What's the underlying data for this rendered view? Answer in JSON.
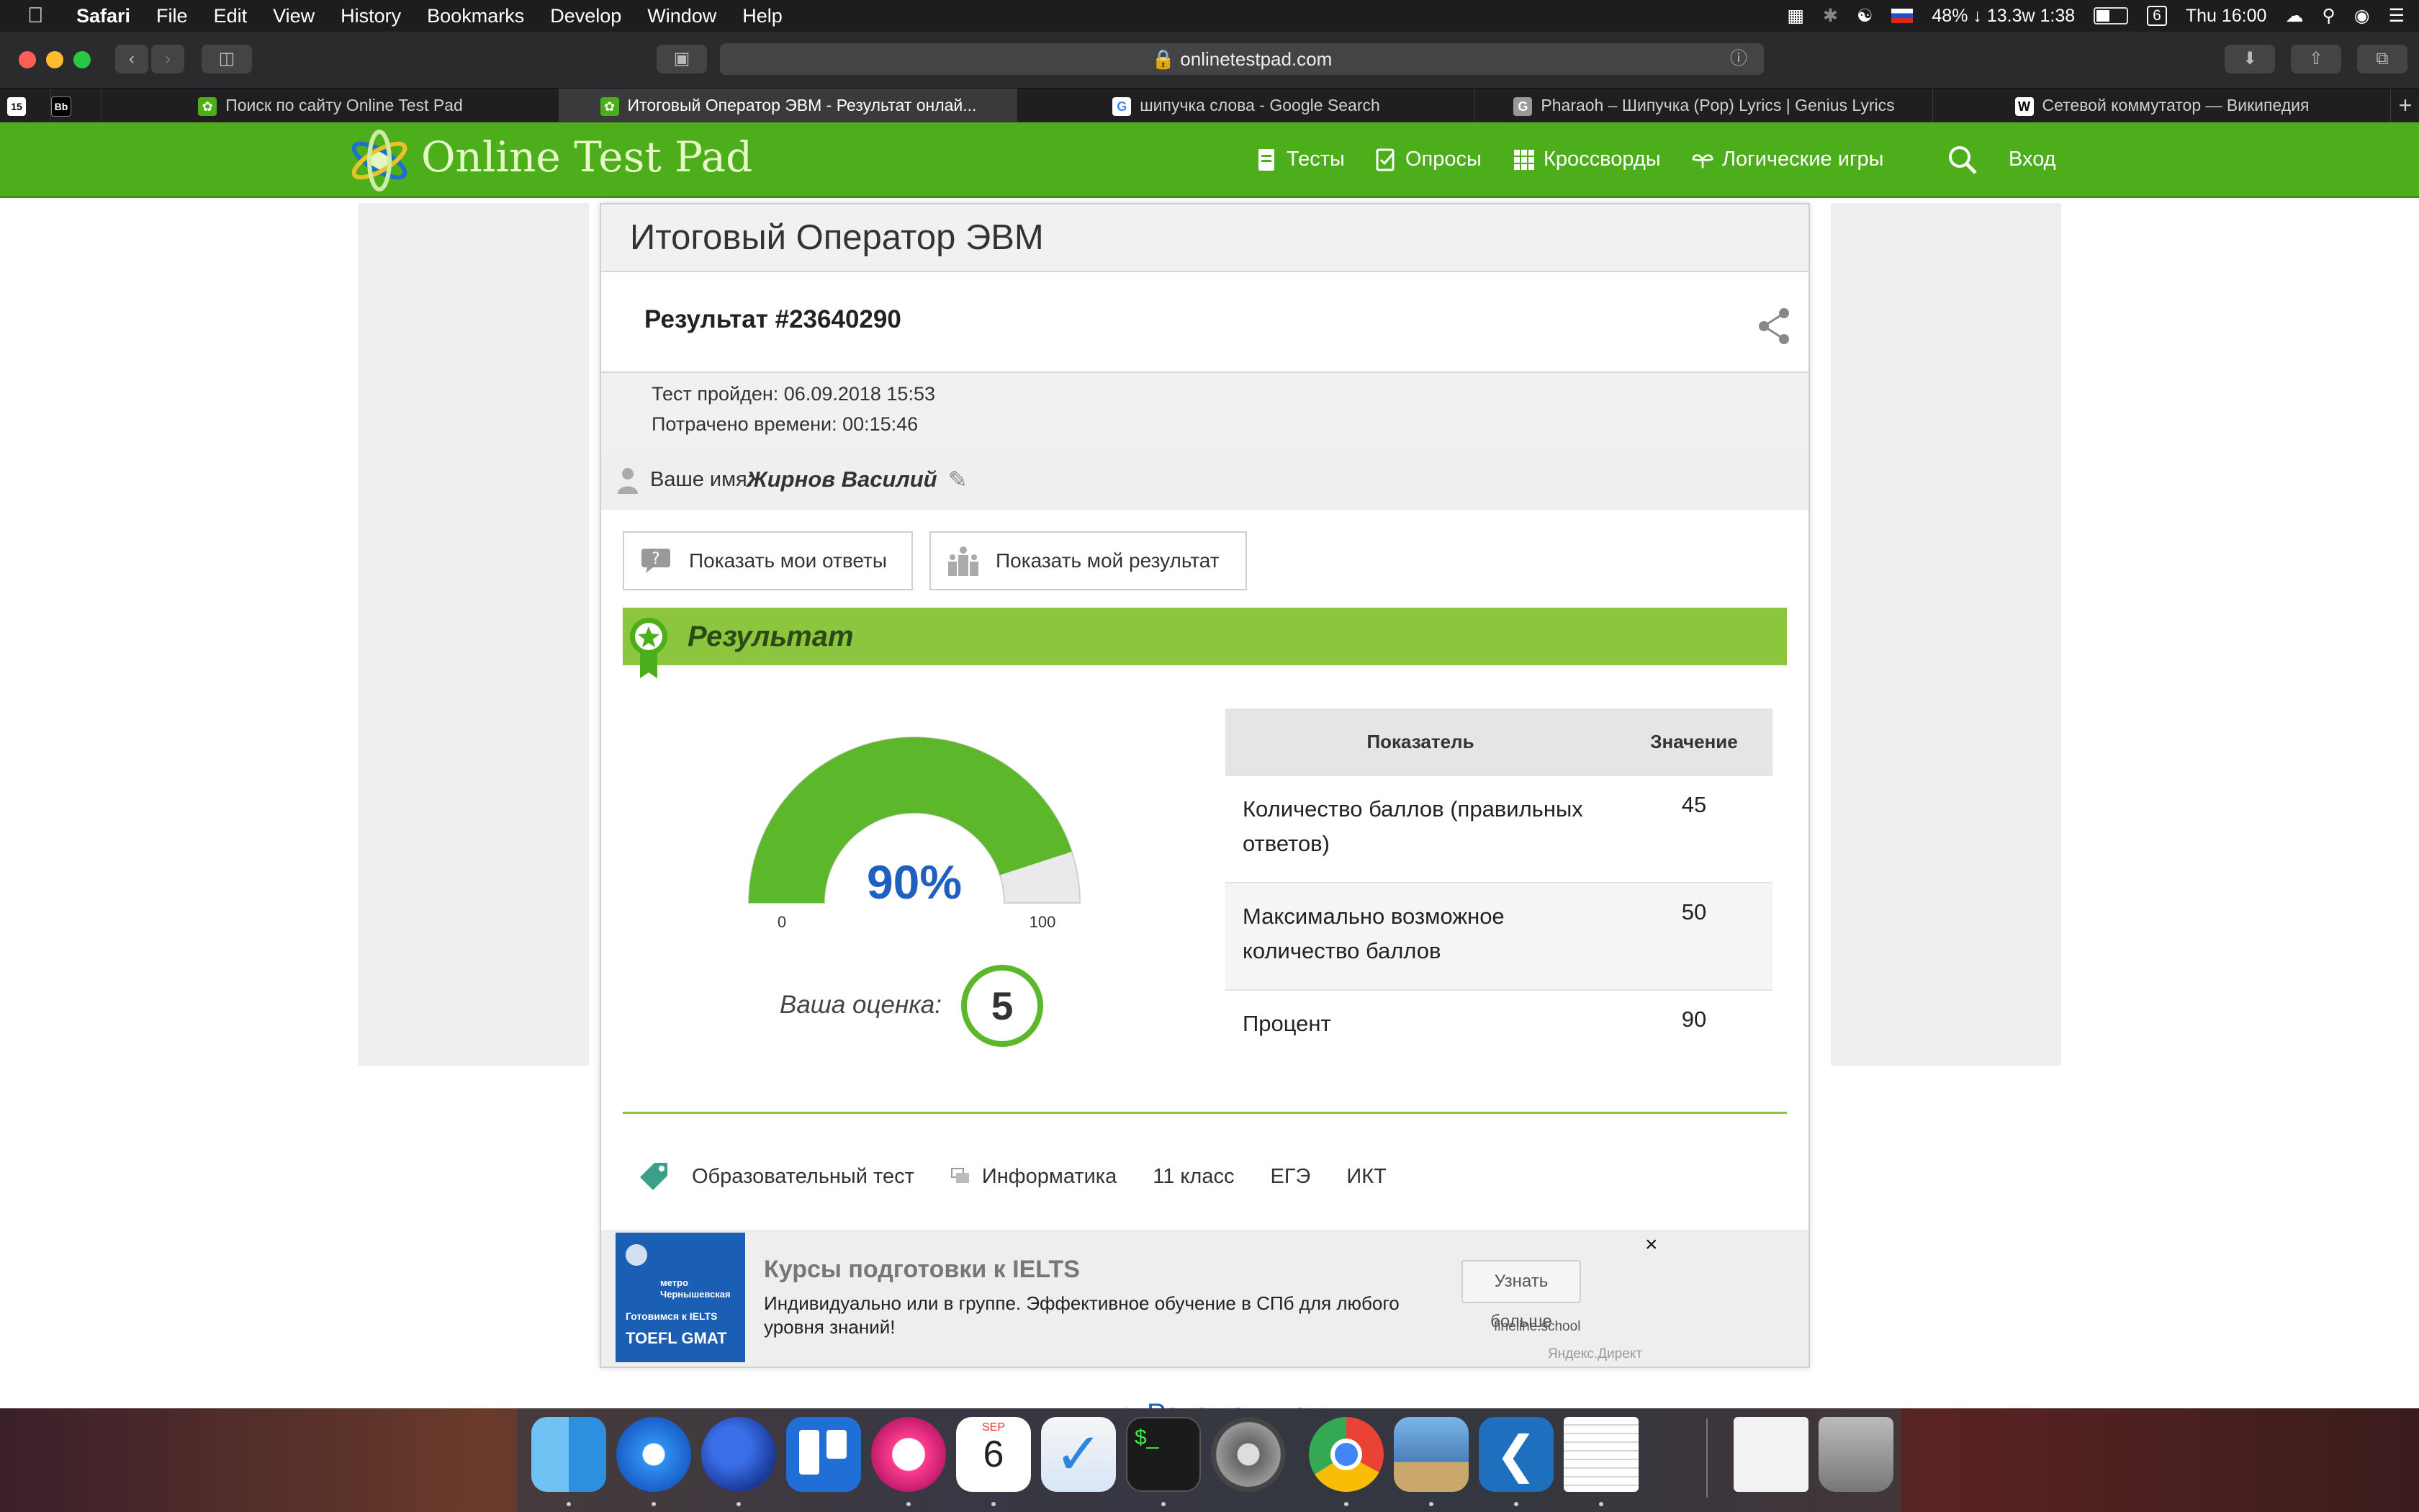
{
  "menubar": {
    "app": "Safari",
    "items": [
      "File",
      "Edit",
      "View",
      "History",
      "Bookmarks",
      "Develop",
      "Window",
      "Help"
    ],
    "status": {
      "battery_stats": "48% ↓ 13.3w 1:38",
      "badge": "6",
      "clock": "Thu 16:00"
    }
  },
  "toolbar": {
    "url": "onlinetestpad.com"
  },
  "tabs": [
    {
      "title": "Поиск по сайту Online Test Pad"
    },
    {
      "title": "Итоговый Оператор ЭВМ - Результат онлай..."
    },
    {
      "title": "шипучка слова - Google Search"
    },
    {
      "title": "Pharaoh – Шипучка (Pop) Lyrics | Genius Lyrics"
    },
    {
      "title": "Сетевой коммутатор — Википедия"
    }
  ],
  "site": {
    "logo": "Online Test Pad",
    "nav": {
      "tests": "Тесты",
      "polls": "Опросы",
      "crosswords": "Кроссворды",
      "logic_games": "Логические игры",
      "login": "Вход"
    }
  },
  "result": {
    "test_title": "Итоговый Оператор ЭВМ",
    "result_number": "Результат #23640290",
    "passed": "Тест пройден: 06.09.2018 15:53",
    "time_spent": "Потрачено времени: 00:15:46",
    "name_label": "Ваше имя:",
    "name_value": "Жирнов Василий",
    "show_answers": "Показать мои ответы",
    "show_result": "Показать мой результат",
    "section_title": "Результат",
    "gauge": {
      "percent_label": "90%",
      "value": 90,
      "min": "0",
      "max": "100"
    },
    "grade_label": "Ваша оценка:",
    "grade": "5",
    "table": {
      "headers": [
        "Показатель",
        "Значение"
      ],
      "rows": [
        [
          "Количество баллов (правильных ответов)",
          "45"
        ],
        [
          "Максимально возможное количество баллов",
          "50"
        ],
        [
          "Процент",
          "90"
        ]
      ]
    },
    "tags": [
      "Образовательный тест",
      "Информатика",
      "11 класс",
      "ЕГЭ",
      "ИКТ"
    ]
  },
  "ad": {
    "image_text": {
      "top": "метро Чернышевская",
      "mid": "Готовимся к IELTS",
      "bottom": "TOEFL GMAT"
    },
    "title": "Курсы подготовки к IELTS",
    "text": "Индивидуально или в группе. Эффективное обучение в СПб для любого уровня знаний!",
    "button": "Узнать больше",
    "domain": "fineline.school",
    "network": "Яндекс.Директ",
    "close": "×"
  },
  "below_fold_heading": "Рекомендуем",
  "dock": {
    "calendar_month": "SEP",
    "calendar_day": "6",
    "apps": [
      "finder-icon",
      "safari-icon",
      "firefox-icon",
      "trello-icon",
      "itunes-icon",
      "calendar-icon",
      "things-icon",
      "terminal-icon",
      "system-preferences-icon",
      "chrome-icon",
      "preview-icon",
      "vscode-icon",
      "textedit-icon",
      "documents-icon",
      "trash-icon"
    ]
  },
  "colors": {
    "brand_green": "#4cae1a",
    "banner_green": "#8cc63f",
    "gauge_green": "#5cb82a",
    "percent_blue": "#1f5fbf"
  }
}
